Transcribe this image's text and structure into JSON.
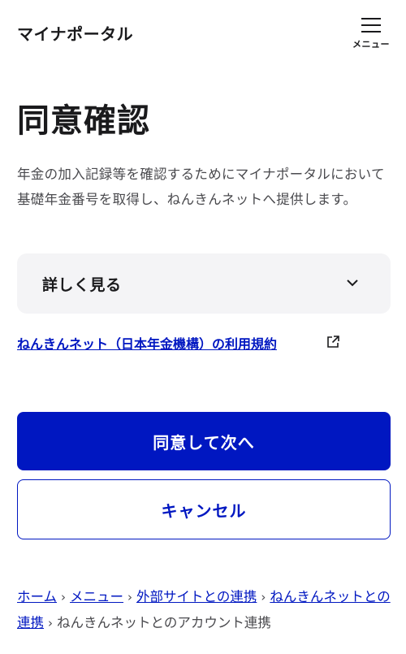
{
  "header": {
    "site_title": "マイナポータル",
    "menu_label": "メニュー"
  },
  "page": {
    "title": "同意確認",
    "description": "年金の加入記録等を確認するためにマイナポータルにおいて基礎年金番号を取得し、ねんきんネットへ提供します。"
  },
  "details": {
    "label": "詳しく見る"
  },
  "terms_link": {
    "text": "ねんきんネット（日本年金機構）の利用規約"
  },
  "buttons": {
    "agree": "同意して次へ",
    "cancel": "キャンセル"
  },
  "breadcrumb": {
    "separator": "›",
    "items": [
      {
        "label": "ホーム"
      },
      {
        "label": "メニュー"
      },
      {
        "label": "外部サイトとの連携"
      },
      {
        "label": "ねんきんネットとの連携"
      }
    ],
    "current": "ねんきんネットとのアカウント連携"
  },
  "icons": {
    "menu": "hamburger-icon",
    "details": "chevron-down-icon",
    "terms": "external-link-icon"
  },
  "colors": {
    "primary": "#0017c1",
    "text": "#1a1a1c",
    "subtext": "#4a4a4e",
    "panel": "#f4f4f6"
  }
}
